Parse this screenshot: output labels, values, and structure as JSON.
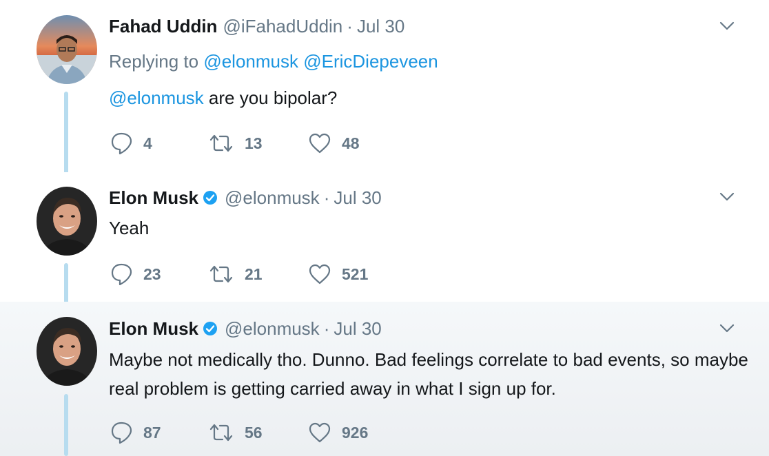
{
  "tweets": [
    {
      "name": "Fahad Uddin",
      "handle": "@iFahadUddin",
      "separator": "·",
      "date": "Jul 30",
      "verified": false,
      "replying_label": "Replying to",
      "replying_to": [
        "@elonmusk",
        "@EricDiepeveen"
      ],
      "text_mention": "@elonmusk",
      "text": "are you bipolar?",
      "replies": "4",
      "retweets": "13",
      "likes": "48"
    },
    {
      "name": "Elon Musk",
      "handle": "@elonmusk",
      "separator": "·",
      "date": "Jul 30",
      "verified": true,
      "text": "Yeah",
      "replies": "23",
      "retweets": "21",
      "likes": "521"
    },
    {
      "name": "Elon Musk",
      "handle": "@elonmusk",
      "separator": "·",
      "date": "Jul 30",
      "verified": true,
      "text": "Maybe not medically tho. Dunno. Bad feelings correlate to bad events, so maybe real problem is getting carried away in what I sign up for.",
      "replies": "87",
      "retweets": "56",
      "likes": "926"
    }
  ],
  "colors": {
    "link": "#1b95e0",
    "secondary_text": "#657786",
    "primary_text": "#14171a",
    "thread_line": "#b7dcef",
    "verified_badge": "#1da1f2"
  },
  "icons": {
    "reply": "reply-icon",
    "retweet": "retweet-icon",
    "like": "heart-icon",
    "menu": "chevron-down-icon",
    "verified": "verified-badge-icon"
  }
}
